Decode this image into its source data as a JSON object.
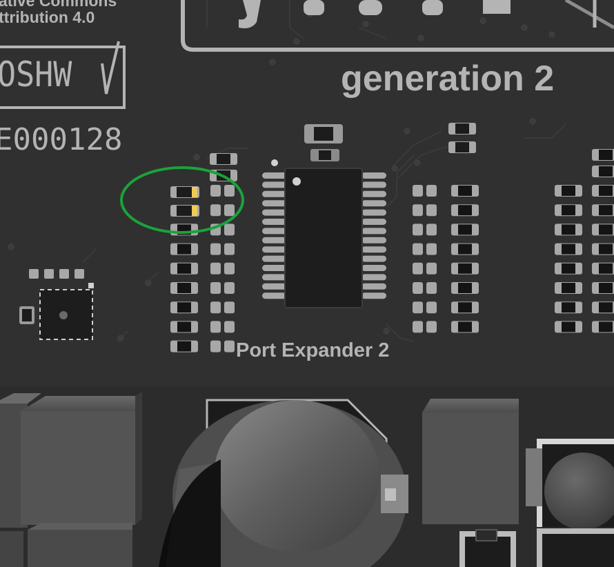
{
  "silkscreen": {
    "license_line1": "ative Commons",
    "license_line2": "ttribution 4.0",
    "oshw_mark": "OSHW",
    "oshw_id": "E000128",
    "title_fragment": "j",
    "generation": "generation 2",
    "port_label": "Port Expander 2"
  },
  "highlight": {
    "shape": "ellipse",
    "color": "#1aa33a"
  },
  "colors": {
    "board": "#303030",
    "component_body": "#1c1c1c",
    "pad": "#a8a8a8",
    "silkscreen": "#b4b4b4",
    "led_accent": "#f0c95a"
  },
  "icons": [
    "oshw-logo-icon",
    "fiducial-icon"
  ]
}
